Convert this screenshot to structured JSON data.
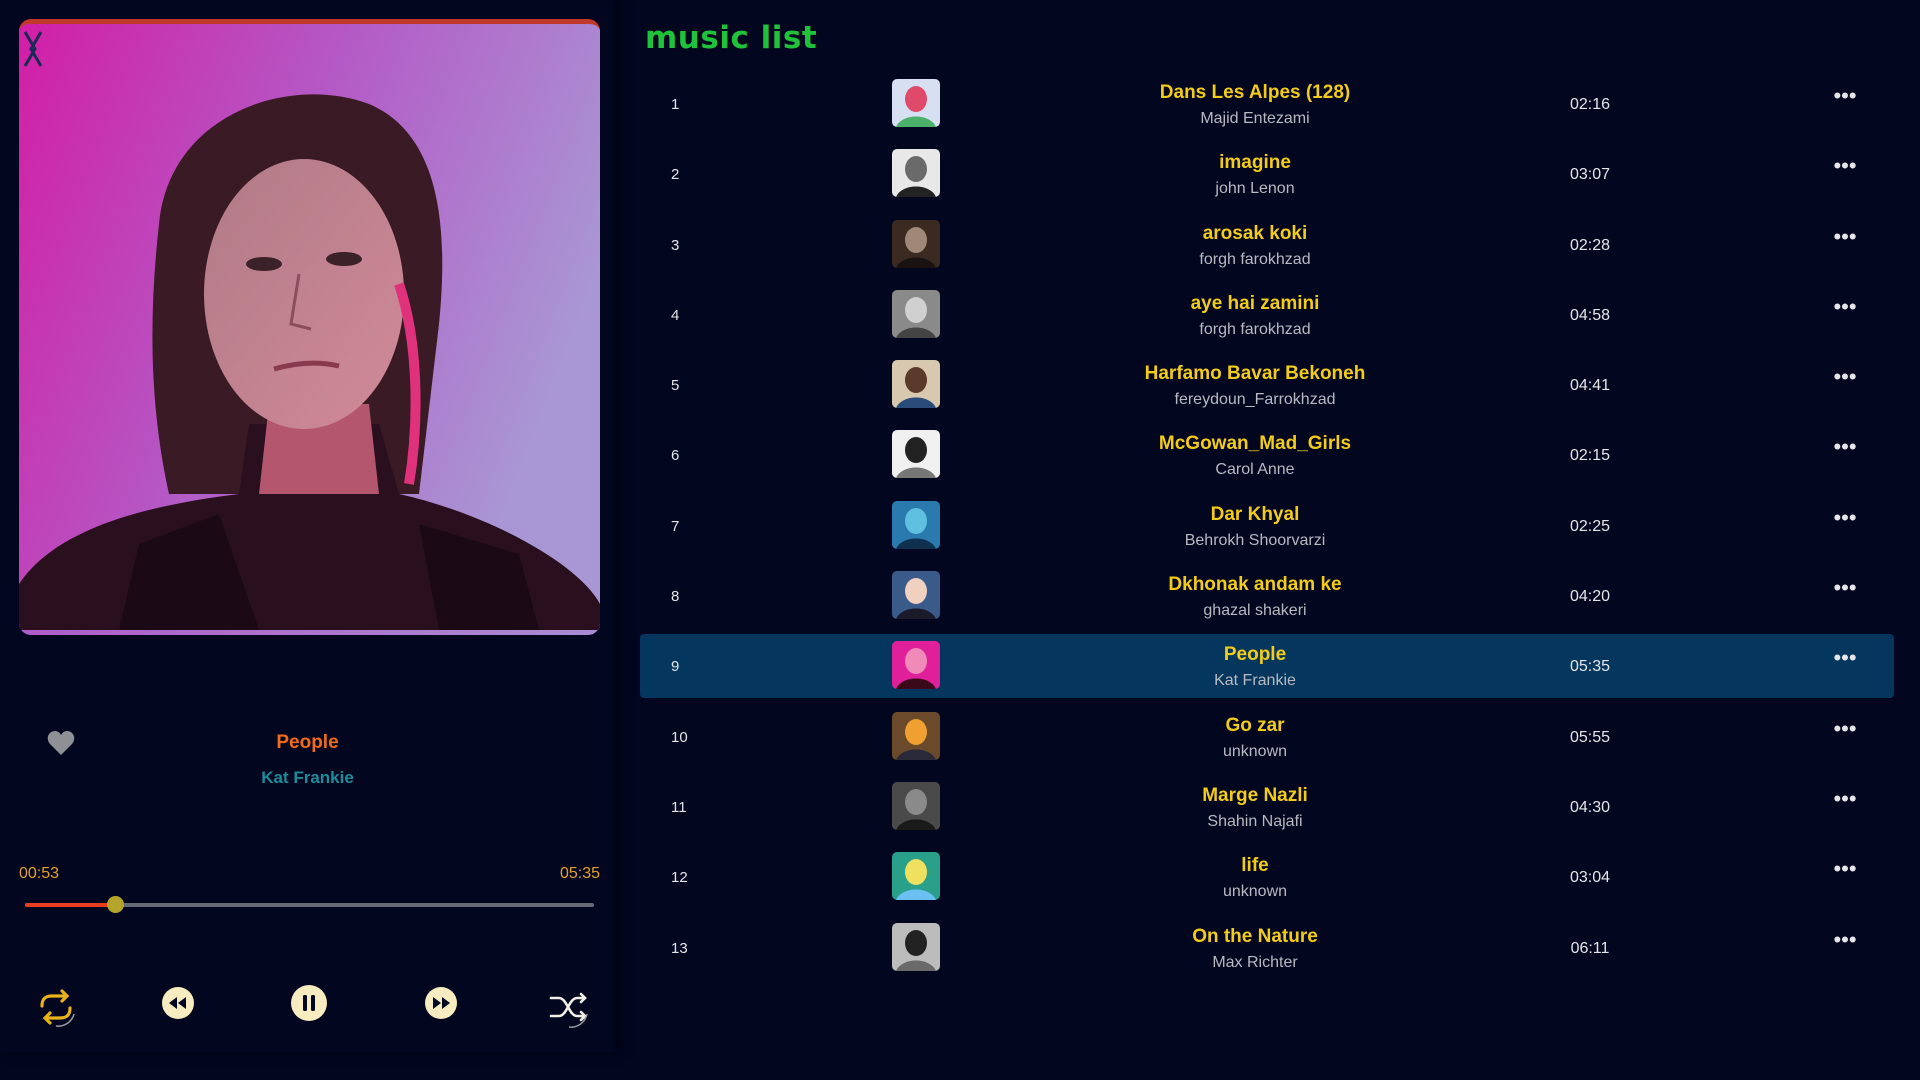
{
  "list_title": "music list",
  "now_playing": {
    "title": "People",
    "artist": "Kat Frankie",
    "current_time": "00:53",
    "duration": "05:35",
    "progress": 0.158
  },
  "icons": {
    "prev_cover": "chevron-left-icon",
    "next_cover": "chevron-right-icon",
    "like": "heart-icon",
    "repeat": "repeat-icon",
    "previous": "rewind-icon",
    "pause": "pause-icon",
    "next": "fast-forward-icon",
    "shuffle": "shuffle-icon",
    "more": "more-horizontal-icon"
  },
  "colors": {
    "background": "#02061f",
    "active_row": "#05375e",
    "song_title": "#f3cc17",
    "now_title": "#f06a1a",
    "now_artist": "#1d8c9a",
    "list_title": "#1fc23a",
    "progress_fill": "#e8401e",
    "control_button": "#f7ecc0"
  },
  "songs": [
    {
      "num": "1",
      "title": "Dans Les Alpes (128)",
      "artist": "Majid Entezami",
      "duration": "02:16",
      "more": "•••"
    },
    {
      "num": "2",
      "title": "imagine",
      "artist": "john Lenon",
      "duration": "03:07",
      "more": "•••"
    },
    {
      "num": "3",
      "title": "arosak koki",
      "artist": "forgh farokhzad",
      "duration": "02:28",
      "more": "•••"
    },
    {
      "num": "4",
      "title": "aye hai zamini",
      "artist": "forgh farokhzad",
      "duration": "04:58",
      "more": "•••"
    },
    {
      "num": "5",
      "title": "Harfamo Bavar Bekoneh",
      "artist": "fereydoun_Farrokhzad",
      "duration": "04:41",
      "more": "•••"
    },
    {
      "num": "6",
      "title": "McGowan_Mad_Girls",
      "artist": "Carol Anne",
      "duration": "02:15",
      "more": "•••"
    },
    {
      "num": "7",
      "title": "Dar Khyal",
      "artist": "Behrokh Shoorvarzi",
      "duration": "02:25",
      "more": "•••"
    },
    {
      "num": "8",
      "title": "Dkhonak andam ke",
      "artist": "ghazal shakeri",
      "duration": "04:20",
      "more": "•••"
    },
    {
      "num": "9",
      "title": "People",
      "artist": "Kat Frankie",
      "duration": "05:35",
      "more": "•••",
      "active": true
    },
    {
      "num": "10",
      "title": "Go zar",
      "artist": "unknown",
      "duration": "05:55",
      "more": "•••"
    },
    {
      "num": "11",
      "title": "Marge Nazli",
      "artist": "Shahin Najafi",
      "duration": "04:30",
      "more": "•••"
    },
    {
      "num": "12",
      "title": "life",
      "artist": "unknown",
      "duration": "03:04",
      "more": "•••"
    },
    {
      "num": "13",
      "title": "On the Nature",
      "artist": "Max Richter",
      "duration": "06:11",
      "more": "•••"
    }
  ]
}
